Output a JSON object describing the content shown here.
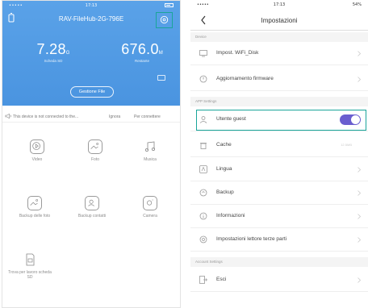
{
  "colors": {
    "header_blue": "#4a94e0",
    "highlight_teal": "#1aa59a",
    "toggle_purple": "#6a5ecf"
  },
  "left": {
    "status": {
      "carrier": "•••••",
      "time": "17:13",
      "battery": "54%"
    },
    "title": "RAV-FileHub-2G-796E",
    "stats": [
      {
        "value": "7.28",
        "unit": "G",
        "label": "Scheda SD"
      },
      {
        "value": "676.0",
        "unit": "M",
        "label": "Restante"
      }
    ],
    "manage_button": "Gestione File",
    "notice": {
      "text": "This device is not connected to the...",
      "ignore": "Ignora",
      "connect": "Per connettere"
    },
    "grid": [
      {
        "label": "Video",
        "icon": "play-icon"
      },
      {
        "label": "Foto",
        "icon": "photo-icon"
      },
      {
        "label": "Musica",
        "icon": "music-icon"
      },
      {
        "label": "Backup delle foto",
        "icon": "photo-backup-icon"
      },
      {
        "label": "Backup contatti",
        "icon": "contacts-backup-icon"
      },
      {
        "label": "Camera",
        "icon": "camera-icon"
      },
      {
        "label": "Trova per lavoro scheda SD",
        "icon": "sd-icon"
      }
    ]
  },
  "right": {
    "status": {
      "carrier": "•••••",
      "time": "17:13",
      "battery": "54%"
    },
    "title": "Impostazioni",
    "sections": {
      "device": "Device",
      "app": "APP Settings",
      "account": "Account Settings"
    },
    "rows": {
      "wifi": "Impost. WiFi_Disk",
      "firmware": "Aggiornamento firmware",
      "guest": "Utente guest",
      "cache": "Cache",
      "cache_size": "12.5MB",
      "language": "Lingua",
      "backup": "Backup",
      "info": "Informazioni",
      "third_party": "Impostazioni lettore terze parti",
      "exit": "Esci"
    },
    "guest_enabled": true
  }
}
